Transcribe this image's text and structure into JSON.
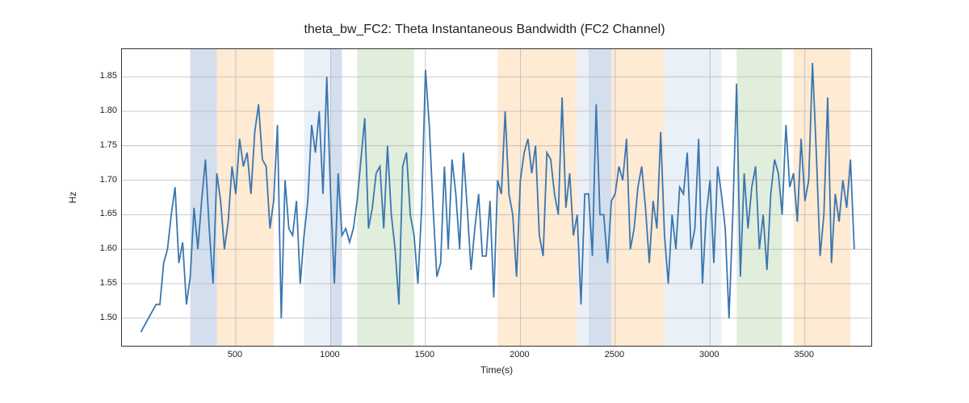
{
  "chart_data": {
    "type": "line",
    "title": "theta_bw_FC2: Theta Instantaneous Bandwidth (FC2 Channel)",
    "xlabel": "Time(s)",
    "ylabel": "Hz",
    "xlim": [
      -100,
      3850
    ],
    "ylim": [
      1.46,
      1.89
    ],
    "xticks": [
      500,
      1000,
      1500,
      2000,
      2500,
      3000,
      3500
    ],
    "yticks": [
      1.5,
      1.55,
      1.6,
      1.65,
      1.7,
      1.75,
      1.8,
      1.85
    ],
    "bands": [
      {
        "x0": 260,
        "x1": 400,
        "color": "#b0c4de"
      },
      {
        "x0": 400,
        "x1": 700,
        "color": "#ffd8b0"
      },
      {
        "x0": 860,
        "x1": 1000,
        "color": "#d8e4f0"
      },
      {
        "x0": 1000,
        "x1": 1060,
        "color": "#b0c4de"
      },
      {
        "x0": 1140,
        "x1": 1440,
        "color": "#c8e0c0"
      },
      {
        "x0": 1880,
        "x1": 2300,
        "color": "#ffd8b0"
      },
      {
        "x0": 2300,
        "x1": 2360,
        "color": "#d8e4f0"
      },
      {
        "x0": 2360,
        "x1": 2480,
        "color": "#b0c4de"
      },
      {
        "x0": 2480,
        "x1": 2760,
        "color": "#ffd8b0"
      },
      {
        "x0": 2760,
        "x1": 3060,
        "color": "#d8e4f0"
      },
      {
        "x0": 3140,
        "x1": 3380,
        "color": "#c8e0c0"
      },
      {
        "x0": 3440,
        "x1": 3740,
        "color": "#ffd8b0"
      }
    ],
    "x": [
      0,
      20,
      40,
      60,
      80,
      100,
      120,
      140,
      160,
      180,
      200,
      220,
      240,
      260,
      280,
      300,
      320,
      340,
      360,
      380,
      400,
      420,
      440,
      460,
      480,
      500,
      520,
      540,
      560,
      580,
      600,
      620,
      640,
      660,
      680,
      700,
      720,
      740,
      760,
      780,
      800,
      820,
      840,
      860,
      880,
      900,
      920,
      940,
      960,
      980,
      1000,
      1020,
      1040,
      1060,
      1080,
      1100,
      1120,
      1140,
      1160,
      1180,
      1200,
      1220,
      1240,
      1260,
      1280,
      1300,
      1320,
      1340,
      1360,
      1380,
      1400,
      1420,
      1440,
      1460,
      1480,
      1500,
      1520,
      1540,
      1560,
      1580,
      1600,
      1620,
      1640,
      1660,
      1680,
      1700,
      1720,
      1740,
      1760,
      1780,
      1800,
      1820,
      1840,
      1860,
      1880,
      1900,
      1920,
      1940,
      1960,
      1980,
      2000,
      2020,
      2040,
      2060,
      2080,
      2100,
      2120,
      2140,
      2160,
      2180,
      2200,
      2220,
      2240,
      2260,
      2280,
      2300,
      2320,
      2340,
      2360,
      2380,
      2400,
      2420,
      2440,
      2460,
      2480,
      2500,
      2520,
      2540,
      2560,
      2580,
      2600,
      2620,
      2640,
      2660,
      2680,
      2700,
      2720,
      2740,
      2760,
      2780,
      2800,
      2820,
      2840,
      2860,
      2880,
      2900,
      2920,
      2940,
      2960,
      2980,
      3000,
      3020,
      3040,
      3060,
      3080,
      3100,
      3120,
      3140,
      3160,
      3180,
      3200,
      3220,
      3240,
      3260,
      3280,
      3300,
      3320,
      3340,
      3360,
      3380,
      3400,
      3420,
      3440,
      3460,
      3480,
      3500,
      3520,
      3540,
      3560,
      3580,
      3600,
      3620,
      3640,
      3660,
      3680,
      3700,
      3720,
      3740,
      3760
    ],
    "values": [
      1.48,
      1.49,
      1.5,
      1.51,
      1.52,
      1.52,
      1.58,
      1.6,
      1.65,
      1.69,
      1.58,
      1.61,
      1.52,
      1.56,
      1.66,
      1.6,
      1.67,
      1.73,
      1.63,
      1.55,
      1.71,
      1.67,
      1.6,
      1.64,
      1.72,
      1.68,
      1.76,
      1.72,
      1.74,
      1.68,
      1.77,
      1.81,
      1.73,
      1.72,
      1.63,
      1.67,
      1.78,
      1.5,
      1.7,
      1.63,
      1.62,
      1.67,
      1.55,
      1.62,
      1.67,
      1.78,
      1.74,
      1.8,
      1.68,
      1.85,
      1.68,
      1.55,
      1.71,
      1.62,
      1.63,
      1.61,
      1.63,
      1.67,
      1.73,
      1.79,
      1.63,
      1.66,
      1.71,
      1.72,
      1.63,
      1.75,
      1.65,
      1.6,
      1.52,
      1.72,
      1.74,
      1.65,
      1.62,
      1.55,
      1.66,
      1.86,
      1.78,
      1.66,
      1.56,
      1.58,
      1.72,
      1.6,
      1.73,
      1.68,
      1.6,
      1.74,
      1.66,
      1.57,
      1.63,
      1.68,
      1.59,
      1.59,
      1.67,
      1.53,
      1.7,
      1.68,
      1.8,
      1.68,
      1.65,
      1.56,
      1.7,
      1.74,
      1.76,
      1.71,
      1.75,
      1.62,
      1.59,
      1.74,
      1.73,
      1.68,
      1.65,
      1.82,
      1.66,
      1.71,
      1.62,
      1.65,
      1.52,
      1.68,
      1.68,
      1.59,
      1.81,
      1.65,
      1.65,
      1.58,
      1.67,
      1.68,
      1.72,
      1.7,
      1.76,
      1.6,
      1.63,
      1.69,
      1.72,
      1.66,
      1.58,
      1.67,
      1.63,
      1.77,
      1.62,
      1.55,
      1.65,
      1.6,
      1.69,
      1.68,
      1.74,
      1.6,
      1.63,
      1.76,
      1.55,
      1.65,
      1.7,
      1.58,
      1.72,
      1.68,
      1.63,
      1.5,
      1.65,
      1.84,
      1.56,
      1.71,
      1.63,
      1.69,
      1.72,
      1.6,
      1.65,
      1.57,
      1.68,
      1.73,
      1.71,
      1.65,
      1.78,
      1.69,
      1.71,
      1.64,
      1.76,
      1.67,
      1.7,
      1.87,
      1.74,
      1.59,
      1.65,
      1.82,
      1.58,
      1.68,
      1.64,
      1.7,
      1.66,
      1.73,
      1.6
    ]
  }
}
